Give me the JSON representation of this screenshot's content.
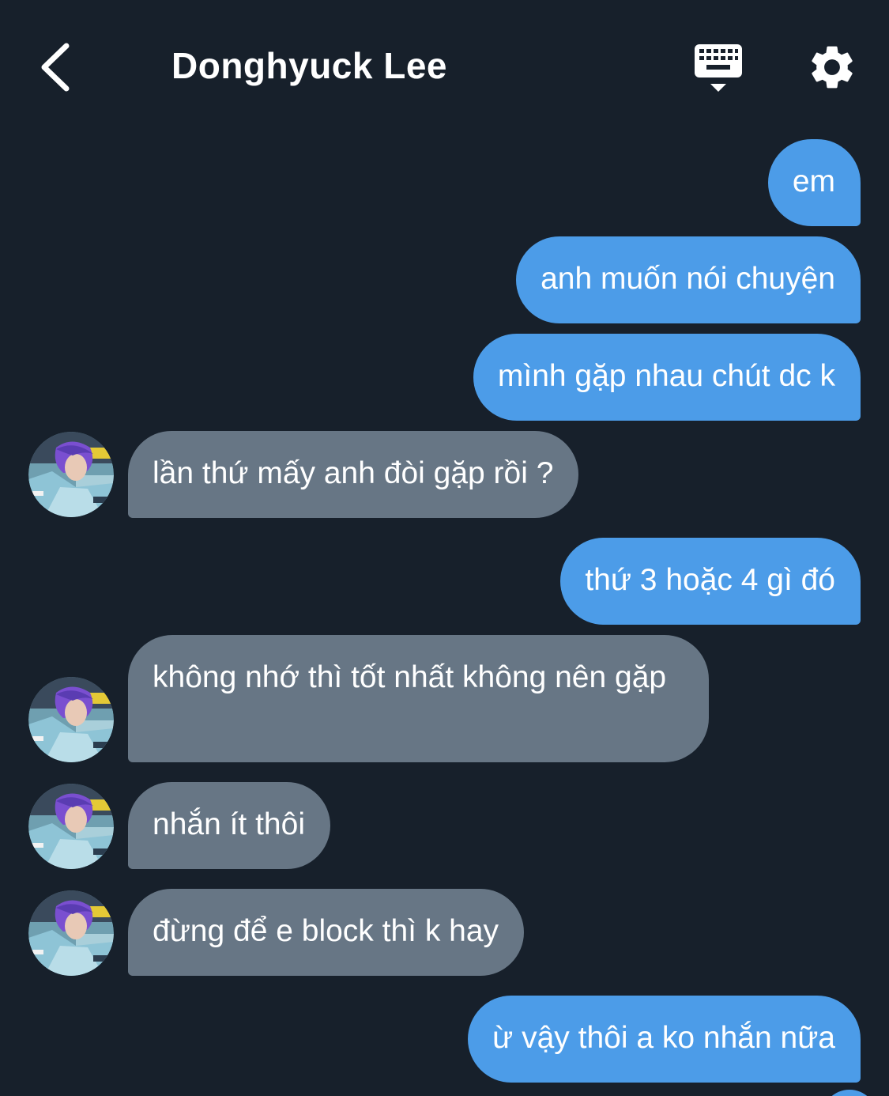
{
  "header": {
    "title": "Donghyuck Lee",
    "back_icon": "chevron-left-icon",
    "keyboard_icon": "keyboard-hide-icon",
    "settings_icon": "gear-icon"
  },
  "colors": {
    "background": "#17202b",
    "outgoing_bubble": "#4c9ce8",
    "incoming_bubble": "#677685",
    "text": "#ffffff"
  },
  "messages": [
    {
      "from": "me",
      "text": "em"
    },
    {
      "from": "me",
      "text": "anh muốn nói chuyện"
    },
    {
      "from": "me",
      "text": "mình gặp nhau chút dc k"
    },
    {
      "from": "them",
      "text": "lần thứ mấy anh đòi gặp rồi ?"
    },
    {
      "from": "me",
      "text": "thứ 3 hoặc 4 gì đó"
    },
    {
      "from": "them",
      "text": "không nhớ thì tốt nhất không nên gặp"
    },
    {
      "from": "them",
      "text": "nhắn ít thôi"
    },
    {
      "from": "them",
      "text": "đừng để e block thì k hay"
    },
    {
      "from": "me",
      "text": "ừ vậy thôi a ko nhắn nữa"
    }
  ]
}
